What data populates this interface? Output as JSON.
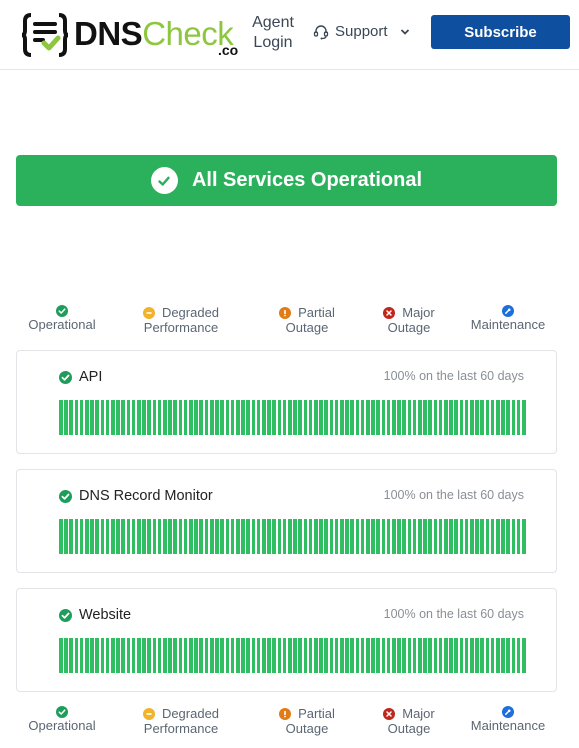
{
  "header": {
    "logo": {
      "dns": "DNS",
      "check": "Check",
      "tld": ".co",
      "icon": "dnscheck-logo-icon"
    },
    "agent_login_line1": "Agent",
    "agent_login_line2": "Login",
    "support_label": "Support",
    "subscribe_label": "Subscribe"
  },
  "banner": {
    "text": "All Services Operational",
    "icon": "check-circle-icon",
    "color": "#2bb15c"
  },
  "legend": [
    {
      "line1": "",
      "line2": "Operational",
      "icon": "check-icon",
      "color": "#1f9d5a"
    },
    {
      "line1": "Degraded",
      "line2": "Performance",
      "icon": "minus-icon",
      "color": "#f1b32b"
    },
    {
      "line1": "Partial",
      "line2": "Outage",
      "icon": "exclamation-icon",
      "color": "#e07b16"
    },
    {
      "line1": "Major",
      "line2": "Outage",
      "icon": "x-icon",
      "color": "#c0261b"
    },
    {
      "line1": "",
      "line2": "Maintenance",
      "icon": "wrench-icon",
      "color": "#1e6fdc"
    }
  ],
  "components": [
    {
      "name": "API",
      "uptime": "100% on the last 60 days",
      "status": "operational",
      "days": 90,
      "bar_color": "#2fbf62"
    },
    {
      "name": "DNS Record Monitor",
      "uptime": "100% on the last 60 days",
      "status": "operational",
      "days": 90,
      "bar_color": "#2fbf62"
    },
    {
      "name": "Website",
      "uptime": "100% on the last 60 days",
      "status": "operational",
      "days": 90,
      "bar_color": "#2fbf62"
    }
  ]
}
